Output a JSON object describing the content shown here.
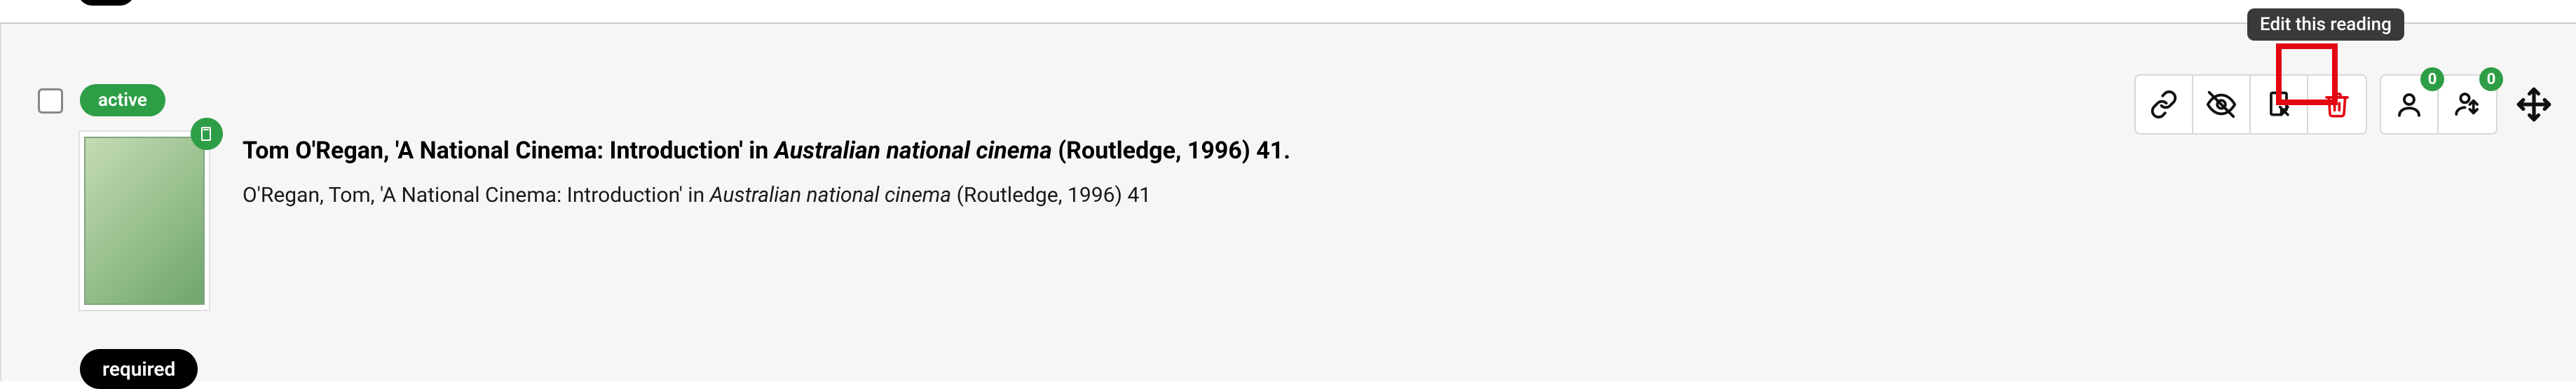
{
  "tooltip": {
    "edit": "Edit this reading"
  },
  "reading": {
    "status_label": "active",
    "importance_label": "required",
    "title_author_part": "Tom O'Regan, 'A National Cinema: Introduction' in ",
    "title_italic_part": "Australian national cinema",
    "title_tail_part": " (Routledge, 1996) 41.",
    "sub_author_part": "O'Regan, Tom, 'A National Cinema: Introduction' in ",
    "sub_italic_part": "Australian national cinema",
    "sub_tail_part": " (Routledge, 1996) 41"
  },
  "badges": {
    "instructors_count": "0",
    "students_count": "0"
  },
  "icons": {
    "link": "link-icon",
    "hide": "visibility-off-icon",
    "edit": "edit-note-icon",
    "delete": "trash-icon",
    "instructor": "person-icon",
    "student": "person-swap-icon",
    "drag": "move-icon",
    "book": "book-icon"
  },
  "colors": {
    "accent_green": "#2e9e46",
    "danger_red": "#e30613",
    "toolbar_border": "#d8d8d8",
    "row_bg": "#f6f6f6"
  }
}
